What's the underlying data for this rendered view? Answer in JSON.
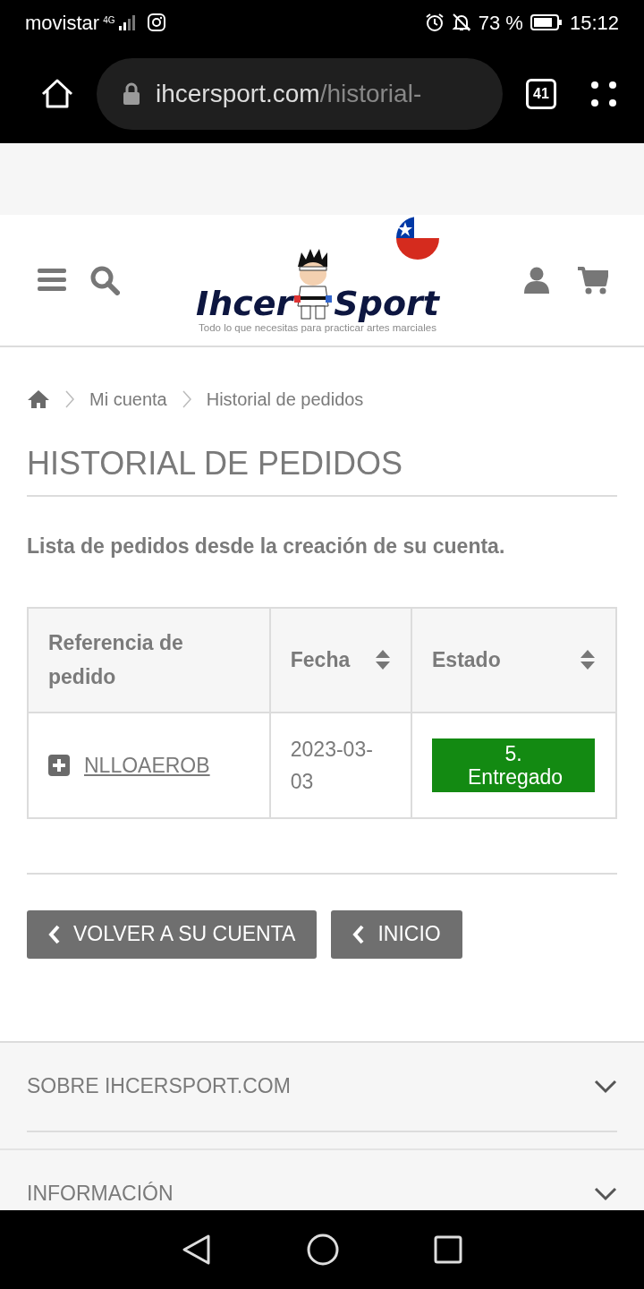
{
  "status_bar": {
    "carrier": "movistar",
    "network": "4G",
    "battery": "73 %",
    "time": "15:12"
  },
  "browser": {
    "url_host": "ihcersport.com",
    "url_path": "/historial-",
    "tab_count": "41"
  },
  "header": {
    "logo_left": "Ihcer",
    "logo_right": "Sport",
    "tagline": "Todo lo que necesitas para practicar artes marciales"
  },
  "breadcrumb": [
    "Mi cuenta",
    "Historial de pedidos"
  ],
  "page_title": "HISTORIAL DE PEDIDOS",
  "subtitle": "Lista de pedidos desde la creación de su cuenta.",
  "table": {
    "columns": [
      {
        "label": "Referencia de pedido",
        "sortable": false
      },
      {
        "label": "Fecha",
        "sortable": true
      },
      {
        "label": "Estado",
        "sortable": true
      }
    ],
    "rows": [
      {
        "reference": "NLLOAEROB",
        "date": "2023-03-03",
        "status": "5. Entregado",
        "color": "#138a12"
      }
    ]
  },
  "buttons": [
    "VOLVER A SU CUENTA",
    "INICIO"
  ],
  "footer": [
    {
      "label": "SOBRE IHCERSPORT.COM",
      "expanded": false
    },
    {
      "label": "INFORMACIÓN",
      "expanded": false
    }
  ]
}
